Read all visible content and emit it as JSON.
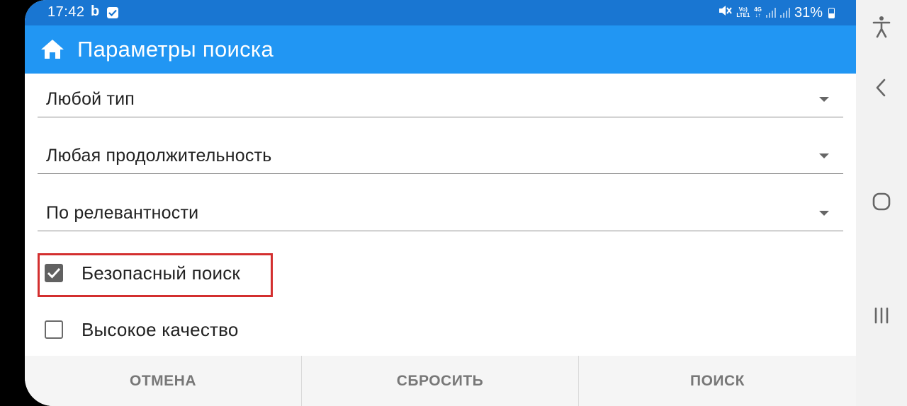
{
  "status_bar": {
    "time": "17:42",
    "notification_letter": "b",
    "volte_line1": "Vo)",
    "volte_line2": "LTE1",
    "network_line1": "4G",
    "network_line2": "↓↑",
    "battery_percent": "31%"
  },
  "app_bar": {
    "title": "Параметры поиска",
    "icon": "home-icon"
  },
  "filters": {
    "type_select": {
      "selected": "Любой тип"
    },
    "duration_select": {
      "selected": "Любая продолжительность"
    },
    "sort_select": {
      "selected": "По релевантности"
    }
  },
  "options": {
    "safe_search": {
      "label": "Безопасный поиск",
      "checked": true
    },
    "high_quality": {
      "label": "Высокое качество",
      "checked": false
    }
  },
  "buttons": {
    "cancel": "ОТМЕНА",
    "reset": "СБРОСИТЬ",
    "search": "ПОИСК"
  },
  "nav_bar": {
    "icons": [
      "accessibility-icon",
      "back-icon",
      "home-circle-icon",
      "recents-icon"
    ]
  },
  "colors": {
    "status_bar": "#1976d2",
    "app_bar": "#2196f3",
    "highlight": "#d32f2f",
    "checkbox_checked": "#616161"
  }
}
